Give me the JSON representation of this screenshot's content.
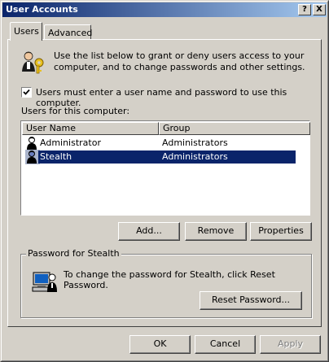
{
  "window": {
    "title": "User Accounts",
    "help_glyph": "?",
    "close_glyph": "X"
  },
  "tabs": [
    {
      "label": "Users",
      "active": true
    },
    {
      "label": "Advanced",
      "active": false
    }
  ],
  "intro": {
    "icon": "users-key-icon",
    "text": "Use the list below to grant or deny users access to your computer, and to change passwords and other settings."
  },
  "require_login": {
    "checked": true,
    "label": "Users must enter a user name and password to use this computer."
  },
  "users_list": {
    "label": "Users for this computer:",
    "columns": [
      "User Name",
      "Group"
    ],
    "rows": [
      {
        "name": "Administrator",
        "group": "Administrators",
        "selected": false
      },
      {
        "name": "Stealth",
        "group": "Administrators",
        "selected": true
      }
    ]
  },
  "list_buttons": {
    "add": "Add...",
    "remove": "Remove",
    "properties": "Properties"
  },
  "password_group": {
    "title": "Password for Stealth",
    "icon": "computer-user-icon",
    "text": "To change the password for Stealth, click Reset Password.",
    "reset_label": "Reset Password..."
  },
  "dialog_buttons": {
    "ok": "OK",
    "cancel": "Cancel",
    "apply": "Apply",
    "apply_enabled": false
  },
  "colors": {
    "selection": "#0a246a",
    "titlebar_start": "#0a246a",
    "titlebar_end": "#a6caf0",
    "face": "#d4d0c8"
  }
}
